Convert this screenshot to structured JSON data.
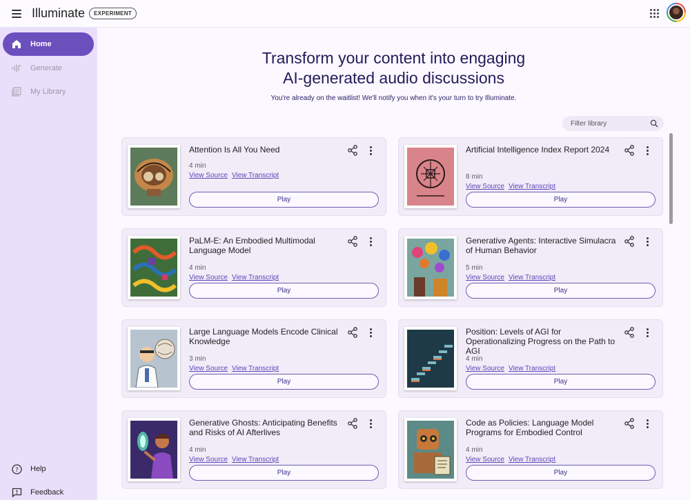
{
  "header": {
    "title": "Illuminate",
    "badge": "EXPERIMENT"
  },
  "sidebar": {
    "items": [
      {
        "label": "Home",
        "icon": "home-icon",
        "active": true
      },
      {
        "label": "Generate",
        "icon": "waveform-icon",
        "active": false
      },
      {
        "label": "My Library",
        "icon": "library-icon",
        "active": false
      }
    ],
    "bottom": [
      {
        "label": "Help",
        "icon": "help-icon"
      },
      {
        "label": "Feedback",
        "icon": "feedback-icon"
      }
    ]
  },
  "hero": {
    "title_line1": "Transform your content into engaging",
    "title_line2": "AI-generated audio discussions",
    "subtitle": "You're already on the waitlist! We'll notify you when it's your turn to try Illuminate."
  },
  "filter": {
    "placeholder": "Filter library"
  },
  "cards": [
    {
      "title": "Attention Is All You Need",
      "duration": "4 min",
      "source_label": "View Source",
      "transcript_label": "View Transcript",
      "play_label": "Play"
    },
    {
      "title": "Artificial Intelligence Index Report 2024",
      "duration": "8 min",
      "source_label": "View Source",
      "transcript_label": "View Transcript",
      "play_label": "Play"
    },
    {
      "title": "PaLM-E: An Embodied Multimodal Language Model",
      "duration": "4 min",
      "source_label": "View Source",
      "transcript_label": "View Transcript",
      "play_label": "Play"
    },
    {
      "title": "Generative Agents: Interactive Simulacra of Human Behavior",
      "duration": "5 min",
      "source_label": "View Source",
      "transcript_label": "View Transcript",
      "play_label": "Play"
    },
    {
      "title": "Large Language Models Encode Clinical Knowledge",
      "duration": "3 min",
      "source_label": "View Source",
      "transcript_label": "View Transcript",
      "play_label": "Play"
    },
    {
      "title": "Position: Levels of AGI for Operationalizing Progress on the Path to AGI",
      "duration": "4 min",
      "source_label": "View Source",
      "transcript_label": "View Transcript",
      "play_label": "Play"
    },
    {
      "title": "Generative Ghosts: Anticipating Benefits and Risks of AI Afterlives",
      "duration": "4 min",
      "source_label": "View Source",
      "transcript_label": "View Transcript",
      "play_label": "Play"
    },
    {
      "title": "Code as Policies: Language Model Programs for Embodied Control",
      "duration": "4 min",
      "source_label": "View Source",
      "transcript_label": "View Transcript",
      "play_label": "Play"
    }
  ],
  "colors": {
    "accent": "#6b4fbd",
    "sidebar_bg": "#eadffb",
    "link": "#5a48b8",
    "title": "#241a5a"
  }
}
